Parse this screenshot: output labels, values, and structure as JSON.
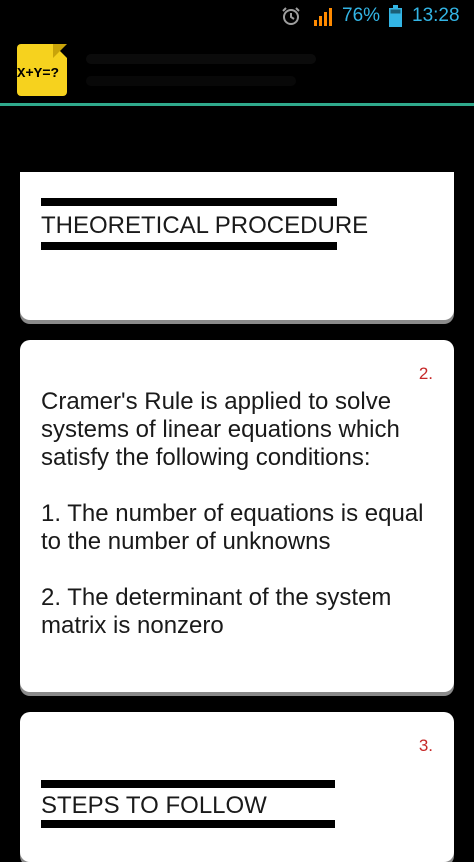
{
  "status_bar": {
    "battery": "76%",
    "time": "13:28",
    "icons": [
      "alarm-icon",
      "signal-icon",
      "battery-icon"
    ],
    "accent_color": "#33b5e5"
  },
  "app": {
    "logo_text": "X+Y=?",
    "logo_color": "#f6d21e",
    "divider_color": "#2fa98c"
  },
  "cards": [
    {
      "heading": "THEORETICAL PROCEDURE"
    },
    {
      "number": "2.",
      "text": "Cramer's Rule is applied to solve systems of linear equations which satisfy the following conditions:\n\n1. The number of equations is equal to the number of unknowns\n\n2. The determinant of the system matrix is nonzero"
    },
    {
      "number": "3.",
      "heading": "STEPS TO FOLLOW"
    }
  ]
}
